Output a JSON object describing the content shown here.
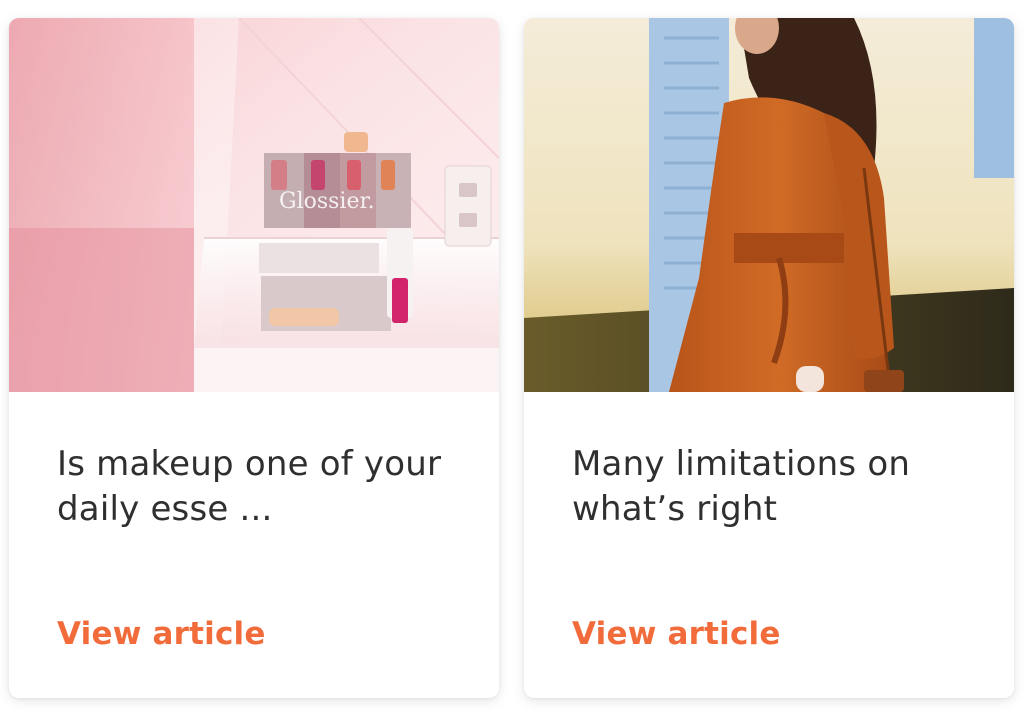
{
  "articles": [
    {
      "image_alt": "Pink makeup display with glossy product boxes",
      "title": "Is makeup one of your daily esse ...",
      "link_label": "View article"
    },
    {
      "image_alt": "Woman in an orange trench dress with a shoulder bag",
      "title": "Many limitations on what’s right",
      "link_label": "View article"
    }
  ],
  "colors": {
    "link": "#f26b3a",
    "title_text": "#2f2f2f",
    "card_background": "#ffffff"
  }
}
